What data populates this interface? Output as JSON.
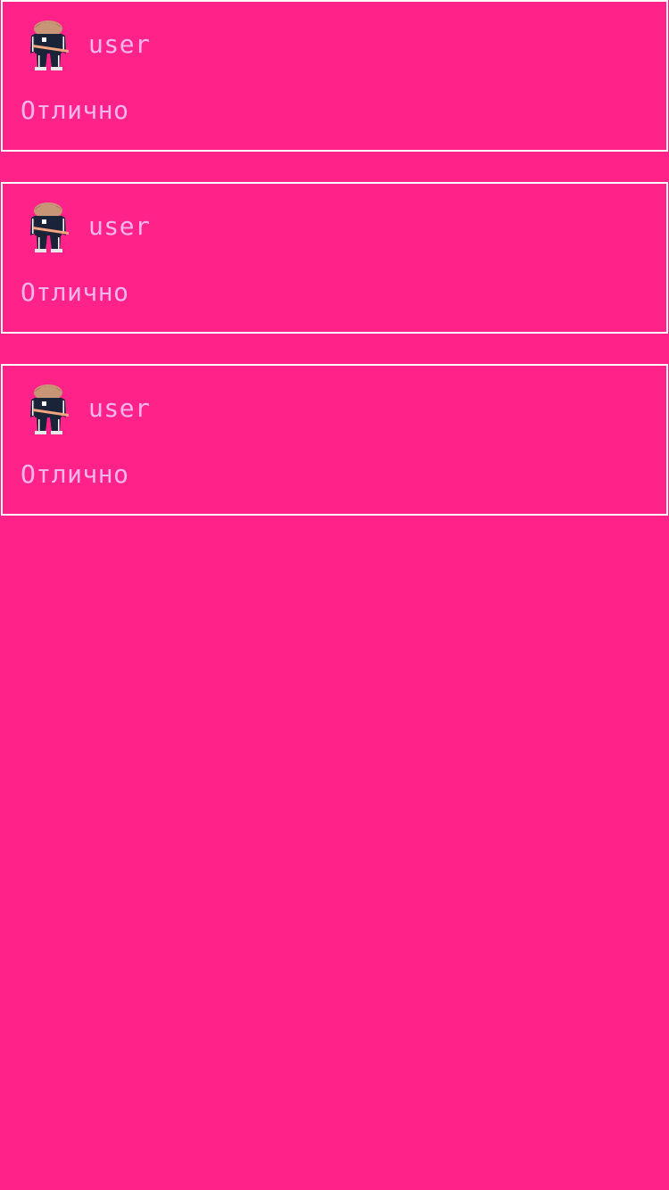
{
  "colors": {
    "background": "#ff2289",
    "card_border": "#ffffff",
    "text": "#f0b5ee"
  },
  "posts": [
    {
      "username": "user",
      "message": "Отлично",
      "avatar_icon": "character-avatar-icon"
    },
    {
      "username": "user",
      "message": "Отлично",
      "avatar_icon": "character-avatar-icon"
    },
    {
      "username": "user",
      "message": "Отлично",
      "avatar_icon": "character-avatar-icon"
    }
  ]
}
